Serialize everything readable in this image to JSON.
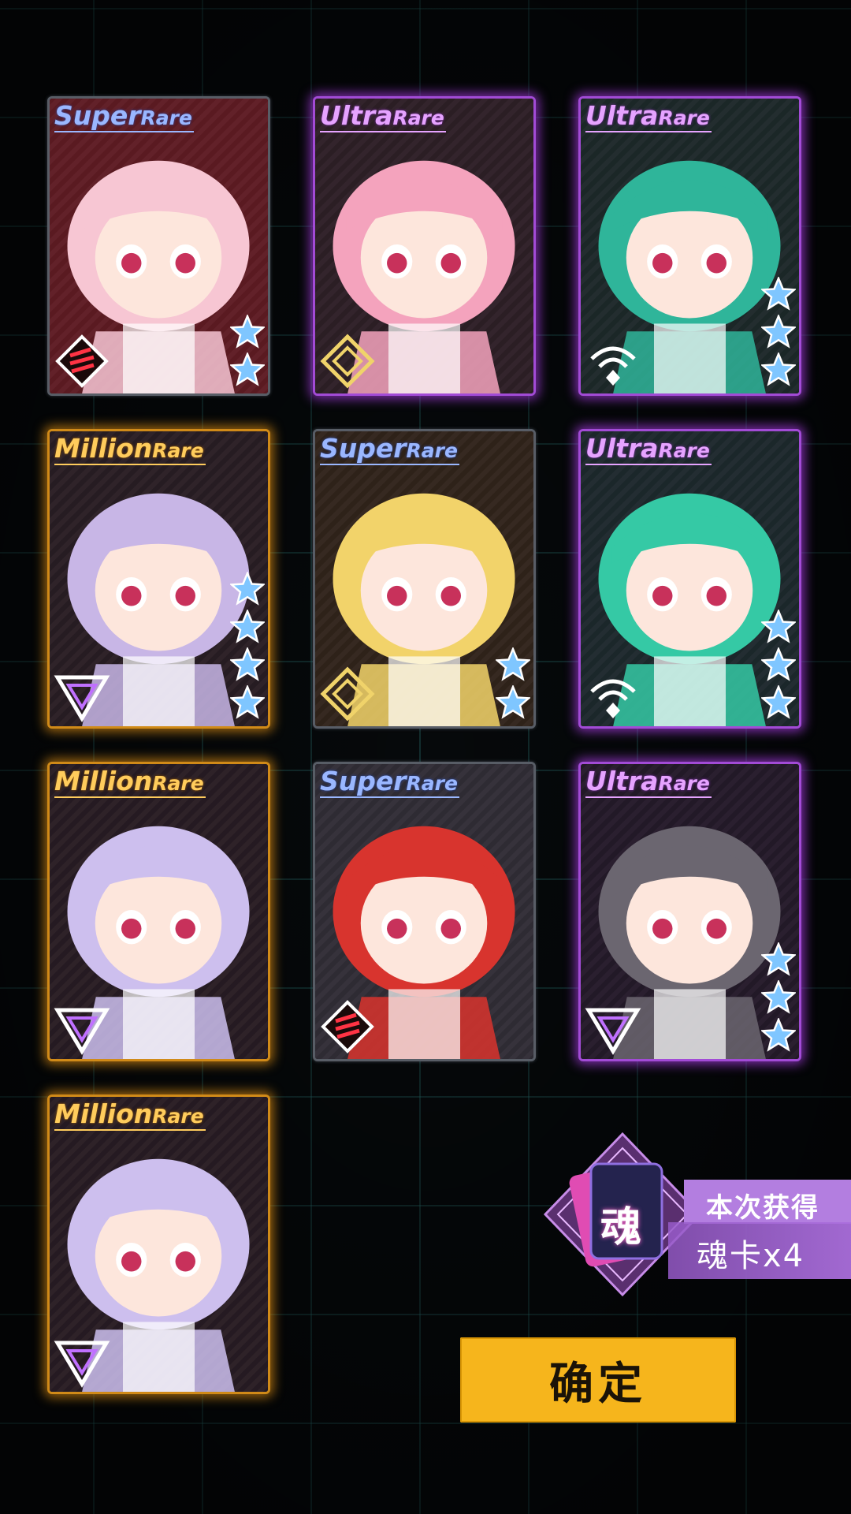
{
  "cards": [
    {
      "id": "c1",
      "rarity_big": "Super",
      "rarity_small": "Rare",
      "tier": "sr",
      "stars": 2,
      "faction": "flag",
      "hair": "#f7c6d3",
      "bg": "#8b1f2a"
    },
    {
      "id": "c2",
      "rarity_big": "Ultra",
      "rarity_small": "Rare",
      "tier": "ur",
      "stars": 0,
      "faction": "diamond",
      "hair": "#f4a3bd",
      "bg": "#3a2a2a"
    },
    {
      "id": "c3",
      "rarity_big": "Ultra",
      "rarity_small": "Rare",
      "tier": "ur",
      "stars": 3,
      "faction": "wifi",
      "hair": "#2fb59a",
      "bg": "#1e3a2f"
    },
    {
      "id": "c4",
      "rarity_big": "Million",
      "rarity_small": "Rare",
      "tier": "mr",
      "stars": 4,
      "faction": "triangle",
      "hair": "#c8b6e6",
      "bg": "#2c2030"
    },
    {
      "id": "c5",
      "rarity_big": "Super",
      "rarity_small": "Rare",
      "tier": "sr",
      "stars": 2,
      "faction": "diamond",
      "hair": "#f2d36a",
      "bg": "#3a2d1c"
    },
    {
      "id": "c6",
      "rarity_big": "Ultra",
      "rarity_small": "Rare",
      "tier": "ur",
      "stars": 3,
      "faction": "wifi",
      "hair": "#35c9a5",
      "bg": "#1e3a34"
    },
    {
      "id": "c7",
      "rarity_big": "Million",
      "rarity_small": "Rare",
      "tier": "mr",
      "stars": 0,
      "faction": "triangle",
      "hair": "#cdbfee",
      "bg": "#2a1f2e"
    },
    {
      "id": "c8",
      "rarity_big": "Super",
      "rarity_small": "Rare",
      "tier": "sr",
      "stars": 0,
      "faction": "flag",
      "hair": "#d8342e",
      "bg": "#3a3e4a"
    },
    {
      "id": "c9",
      "rarity_big": "Ultra",
      "rarity_small": "Rare",
      "tier": "ur",
      "stars": 3,
      "faction": "triangle",
      "hair": "#6b6670",
      "bg": "#2a2030"
    },
    {
      "id": "c10",
      "rarity_big": "Million",
      "rarity_small": "Rare",
      "tier": "mr",
      "stars": 0,
      "faction": "triangle",
      "hair": "#cdbfee",
      "bg": "#2a1f2e"
    }
  ],
  "reward": {
    "soul_char": "魂",
    "label": "本次获得",
    "count_text": "魂卡x4"
  },
  "confirm_label": "确定",
  "colors": {
    "accent": "#f6b51c",
    "ultra": "#a24bd6",
    "million": "#d08a18",
    "super": "#585d66",
    "star": "#7fc6ff"
  }
}
